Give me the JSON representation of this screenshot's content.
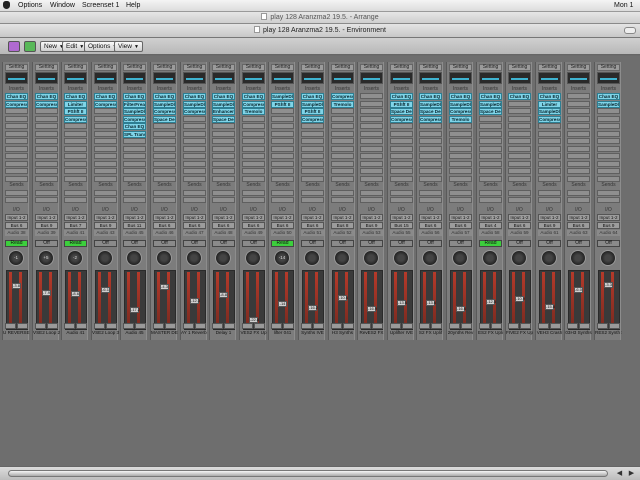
{
  "menubar": {
    "items": [
      "Options",
      "Window",
      "Screenset 1",
      "Help"
    ],
    "clock": "Mon 1"
  },
  "arrange_window": {
    "title": "play 128 Aranzma2 19.5. - Arrange"
  },
  "environment_window": {
    "title": "play 128 Aranzma2 19.5. - Environment"
  },
  "toolbar": {
    "buttons": [
      "New",
      "Edit",
      "Options",
      "View"
    ]
  },
  "mixer": {
    "labels": {
      "setting": "Setting",
      "inserts": "Inserts",
      "sends": "Sends",
      "io": "I/O"
    },
    "strips": [
      {
        "name": "U REVERSE 1",
        "input": "Input 1-2",
        "bus": "Bus 6",
        "out": "Audio 38",
        "auto": "Read",
        "plugins": [
          "Chan EQ",
          "Compress"
        ]
      },
      {
        "name": "VSE2 Loop 2",
        "input": "Input 1-2",
        "bus": "Bus 9",
        "out": "Audio 39",
        "auto": "Off",
        "plugins": [
          "Chan EQ",
          "Compress"
        ]
      },
      {
        "name": "Audio 41",
        "input": "Input 1-2",
        "bus": "Bus 7",
        "out": "Audio 41",
        "auto": "Read",
        "plugins": [
          "Chan EQ",
          "Limiter",
          "PShft II",
          "Compress"
        ]
      },
      {
        "name": "VSE2 Loop 3",
        "input": "Input 1-2",
        "bus": "Bus 9",
        "out": "Audio 43",
        "auto": "Off",
        "plugins": [
          "Chan EQ",
          "Compress"
        ]
      },
      {
        "name": "Audio 45",
        "input": "Input 1-2",
        "bus": "Bus 11",
        "out": "Audio 45",
        "auto": "Off",
        "plugins": [
          "Chan EQ",
          "FilterFreak",
          "SampleDly",
          "Compress",
          "Chan EQ",
          "SPL Transi"
        ]
      },
      {
        "name": "MASTER DEL",
        "input": "Input 1-2",
        "bus": "Bus 6",
        "out": "Audio 46",
        "auto": "Off",
        "plugins": [
          "Chan EQ",
          "SampleDly",
          "Compress",
          "Space Desi"
        ]
      },
      {
        "name": "AY 1 Reverb 1",
        "input": "Input 1-2",
        "bus": "Bus 6",
        "out": "Audio 47",
        "auto": "Off",
        "plugins": [
          "Chan EQ",
          "SampleDly",
          "Compress"
        ]
      },
      {
        "name": "Delay 1",
        "input": "Input 1-2",
        "bus": "Bus 6",
        "out": "Audio 48",
        "auto": "Off",
        "plugins": [
          "Chan EQ",
          "SampleDly",
          "Enhancer",
          "Space Desi"
        ]
      },
      {
        "name": "VES2 FX Up",
        "input": "Input 1-2",
        "bus": "Bus 6",
        "out": "Audio 49",
        "auto": "Off",
        "plugins": [
          "Chan EQ",
          "Compress",
          "Tremolo"
        ]
      },
      {
        "name": "lifter 041",
        "input": "Input 1-2",
        "bus": "Bus 6",
        "out": "Audio 50",
        "auto": "Read",
        "plugins": [
          "SampleDly",
          "PShft II"
        ]
      },
      {
        "name": "Synths IVE",
        "input": "Input 1-2",
        "bus": "Bus 6",
        "out": "Audio 51",
        "auto": "Off",
        "plugins": [
          "Chan EQ",
          "SampleDly",
          "PShft II",
          "Compress"
        ]
      },
      {
        "name": "H3 Synths",
        "input": "Input 1-2",
        "bus": "Bus 8",
        "out": "Audio 52",
        "auto": "Off",
        "plugins": [
          "Compress",
          "Tremolo"
        ]
      },
      {
        "name": "RevES2 FX",
        "input": "Input 1-2",
        "bus": "Bus 9",
        "out": "Audio 53",
        "auto": "Off",
        "plugins": []
      },
      {
        "name": "Uplifter IVE",
        "input": "Input 1-2",
        "bus": "Bus 15",
        "out": "Audio 55",
        "auto": "Off",
        "plugins": [
          "Chan EQ",
          "PShft II",
          "Space Desi",
          "Compress"
        ]
      },
      {
        "name": "S2 FX Uplif",
        "input": "Input 1-2",
        "bus": "Bus 6",
        "out": "Audio 56",
        "auto": "Off",
        "plugins": [
          "Chan EQ",
          "SampleDly",
          "Space Desi",
          "Compress"
        ]
      },
      {
        "name": "20ynths Rev",
        "input": "Input 1-2",
        "bus": "Bus 6",
        "out": "Audio 57",
        "auto": "Off",
        "plugins": [
          "Chan EQ",
          "SampleDly",
          "Compress",
          "Tremolo"
        ]
      },
      {
        "name": "ES2 FX Upli",
        "input": "Input 1-2",
        "bus": "Bus 4",
        "out": "Audio 58",
        "auto": "Read",
        "plugins": [
          "Chan EQ",
          "SampleDly",
          "Space Desi"
        ]
      },
      {
        "name": "FIVE2 FX Up",
        "input": "Input 1-2",
        "bus": "Bus 6",
        "out": "Audio 59",
        "auto": "Off",
        "plugins": [
          "Chan EQ"
        ]
      },
      {
        "name": "VEH3 Crash",
        "input": "Input 1-2",
        "bus": "Bus 9",
        "out": "Audio 61",
        "auto": "Off",
        "plugins": [
          "Chan EQ",
          "Limiter",
          "SampleDly",
          "Compress"
        ]
      },
      {
        "name": "03H3 Synths",
        "input": "Input 1-2",
        "bus": "Bus 6",
        "out": "Audio 63",
        "auto": "Off",
        "plugins": []
      },
      {
        "name": "RES2 Synth S",
        "input": "Input 1-2",
        "bus": "Bus 9",
        "out": "Audio 64",
        "auto": "Off",
        "plugins": [
          "Chan EQ",
          "SampleDly"
        ]
      }
    ],
    "fader_values": [
      "-3.8",
      "-7.9",
      "-8.6",
      "-6.1",
      "-17.2",
      "-4.3",
      "-12.3",
      "-8.8",
      "-22.8",
      "-14",
      "-16.2",
      "-10.6",
      "-16.9",
      "-13.6",
      "-13.6",
      "-16.6",
      "-12.5",
      "-10.9",
      "-15.8",
      "-6.0",
      "-3.3"
    ],
    "pan_values": [
      "-1",
      "+5",
      "-2",
      "",
      "",
      "",
      "",
      "",
      "",
      "-14",
      "",
      "",
      "",
      "",
      "",
      "",
      "",
      "",
      "",
      "",
      ""
    ]
  }
}
